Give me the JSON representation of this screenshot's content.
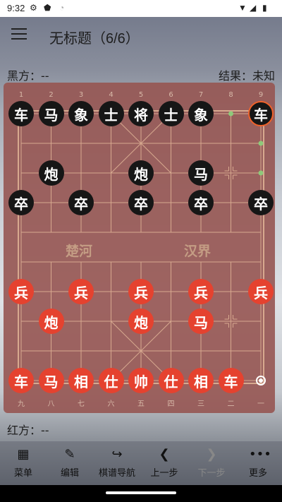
{
  "status": {
    "time": "9:32"
  },
  "app": {
    "title": "无标题（6/6）"
  },
  "players": {
    "black_label": "黑方：--",
    "result_label": "结果：未知",
    "red_label": "红方：--"
  },
  "board": {
    "top_numbers": [
      "1",
      "2",
      "3",
      "4",
      "5",
      "6",
      "7",
      "8",
      "9"
    ],
    "bottom_numbers": [
      "九",
      "八",
      "七",
      "六",
      "五",
      "四",
      "三",
      "二",
      "一"
    ],
    "river_left": "楚河",
    "river_right": "汉界",
    "pieces": [
      {
        "c": 0,
        "r": 0,
        "t": "车",
        "side": "black"
      },
      {
        "c": 1,
        "r": 0,
        "t": "马",
        "side": "black"
      },
      {
        "c": 2,
        "r": 0,
        "t": "象",
        "side": "black"
      },
      {
        "c": 3,
        "r": 0,
        "t": "士",
        "side": "black"
      },
      {
        "c": 4,
        "r": 0,
        "t": "将",
        "side": "black"
      },
      {
        "c": 5,
        "r": 0,
        "t": "士",
        "side": "black"
      },
      {
        "c": 6,
        "r": 0,
        "t": "象",
        "side": "black"
      },
      {
        "c": 8,
        "r": 0,
        "t": "车",
        "side": "black",
        "selected": true
      },
      {
        "c": 1,
        "r": 2,
        "t": "炮",
        "side": "black"
      },
      {
        "c": 4,
        "r": 2,
        "t": "炮",
        "side": "black"
      },
      {
        "c": 6,
        "r": 2,
        "t": "马",
        "side": "black"
      },
      {
        "c": 0,
        "r": 3,
        "t": "卒",
        "side": "black"
      },
      {
        "c": 2,
        "r": 3,
        "t": "卒",
        "side": "black"
      },
      {
        "c": 4,
        "r": 3,
        "t": "卒",
        "side": "black"
      },
      {
        "c": 6,
        "r": 3,
        "t": "卒",
        "side": "black"
      },
      {
        "c": 8,
        "r": 3,
        "t": "卒",
        "side": "black"
      },
      {
        "c": 0,
        "r": 6,
        "t": "兵",
        "side": "red"
      },
      {
        "c": 2,
        "r": 6,
        "t": "兵",
        "side": "red"
      },
      {
        "c": 4,
        "r": 6,
        "t": "兵",
        "side": "red"
      },
      {
        "c": 6,
        "r": 6,
        "t": "兵",
        "side": "red"
      },
      {
        "c": 8,
        "r": 6,
        "t": "兵",
        "side": "red"
      },
      {
        "c": 1,
        "r": 7,
        "t": "炮",
        "side": "red"
      },
      {
        "c": 4,
        "r": 7,
        "t": "炮",
        "side": "red"
      },
      {
        "c": 6,
        "r": 7,
        "t": "马",
        "side": "red"
      },
      {
        "c": 0,
        "r": 9,
        "t": "车",
        "side": "red"
      },
      {
        "c": 1,
        "r": 9,
        "t": "马",
        "side": "red"
      },
      {
        "c": 2,
        "r": 9,
        "t": "相",
        "side": "red"
      },
      {
        "c": 3,
        "r": 9,
        "t": "仕",
        "side": "red"
      },
      {
        "c": 4,
        "r": 9,
        "t": "帅",
        "side": "red"
      },
      {
        "c": 5,
        "r": 9,
        "t": "仕",
        "side": "red"
      },
      {
        "c": 6,
        "r": 9,
        "t": "相",
        "side": "red"
      },
      {
        "c": 7,
        "r": 9,
        "t": "车",
        "side": "red"
      }
    ]
  },
  "nav": {
    "menu": "菜单",
    "edit": "编辑",
    "navigate": "棋谱导航",
    "prev": "上一步",
    "next": "下一步",
    "more": "更多"
  }
}
